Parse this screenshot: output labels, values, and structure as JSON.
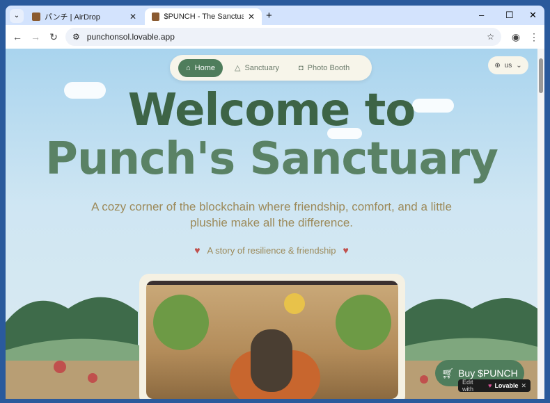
{
  "browser": {
    "tabs": [
      {
        "title": "パンチ | AirDrop"
      },
      {
        "title": "$PUNCH - The Sanctuary Monk"
      }
    ],
    "url": "punchonsol.lovable.app"
  },
  "nav": {
    "items": [
      {
        "label": "Home"
      },
      {
        "label": "Sanctuary"
      },
      {
        "label": "Photo Booth"
      }
    ],
    "language": "us"
  },
  "hero": {
    "title_line1": "Welcome to",
    "title_line2": "Punch's Sanctuary",
    "subtitle": "A cozy corner of the blockchain where friendship, comfort, and a little plushie make all the difference.",
    "story": "A story of resilience & friendship"
  },
  "buy_button": "Buy $PUNCH",
  "lovable_badge": {
    "prefix": "Edit with",
    "brand": "Lovable"
  },
  "colors": {
    "accent": "#4f7d5c",
    "title": "#3d6446",
    "text": "#9c8a5a"
  }
}
